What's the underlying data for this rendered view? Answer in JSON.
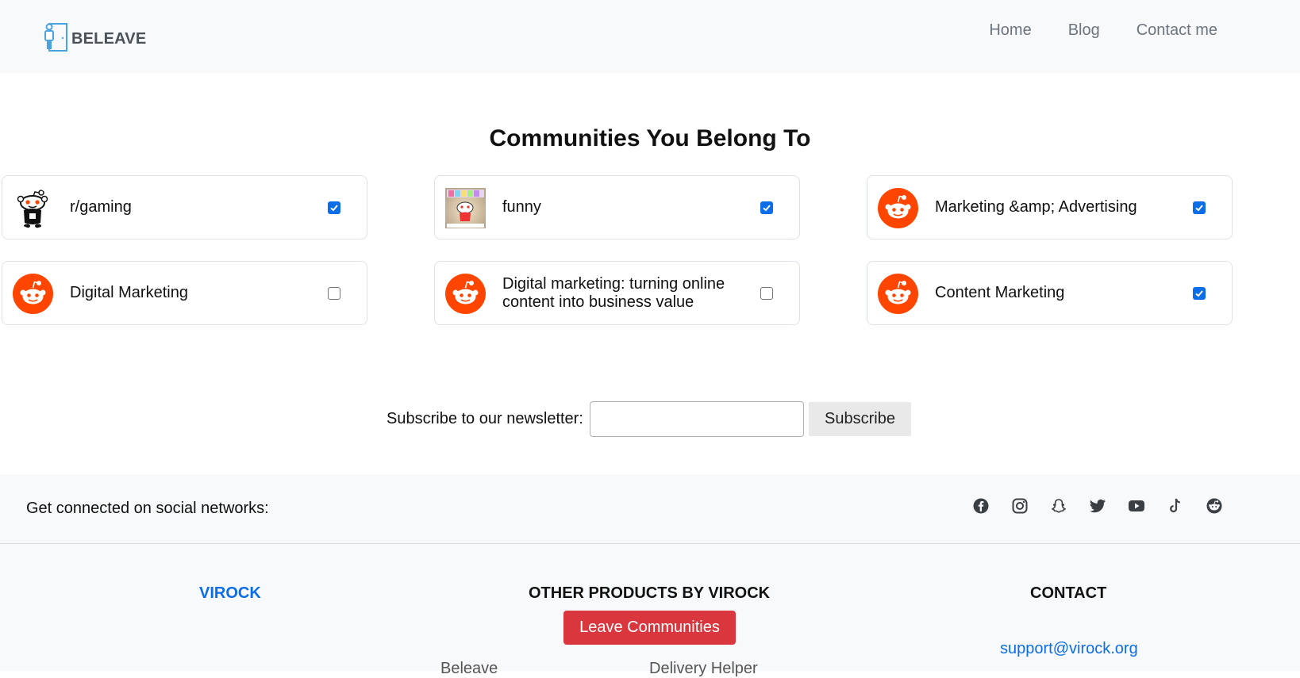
{
  "header": {
    "brand": "BELEAVE",
    "nav": [
      "Home",
      "Blog",
      "Contact me"
    ]
  },
  "main": {
    "title": "Communities You Belong To",
    "communities": [
      {
        "name": "r/gaming",
        "checked": true,
        "avatar": "snoo-gaming-avatar"
      },
      {
        "name": "funny",
        "checked": true,
        "avatar": "funny-avatar"
      },
      {
        "name": "Marketing &amp; Advertising",
        "checked": true,
        "avatar": "reddit-icon"
      },
      {
        "name": "Digital Marketing",
        "checked": false,
        "avatar": "reddit-icon"
      },
      {
        "name": "Digital marketing: turning online content into business value",
        "checked": false,
        "avatar": "reddit-icon"
      },
      {
        "name": "Content Marketing",
        "checked": true,
        "avatar": "reddit-icon"
      }
    ]
  },
  "newsletter": {
    "label": "Subscribe to our newsletter:",
    "input_value": "",
    "button": "Subscribe"
  },
  "social": {
    "label": "Get connected on social networks:",
    "icons": [
      "facebook-icon",
      "instagram-icon",
      "snapchat-icon",
      "twitter-icon",
      "youtube-icon",
      "tiktok-icon",
      "reddit-icon"
    ]
  },
  "footer": {
    "col1_title": "VIROCK",
    "col2_title": "OTHER PRODUCTS BY VIROCK",
    "col3_title": "CONTACT",
    "leave_button": "Leave Communities",
    "products": [
      "Beleave",
      "Delivery Helper"
    ],
    "email": "support@virock.org"
  },
  "colors": {
    "accent": "#0b6ee8",
    "reddit": "#ff4500",
    "danger": "#d9363e",
    "light_bg": "#f8f9fa"
  }
}
